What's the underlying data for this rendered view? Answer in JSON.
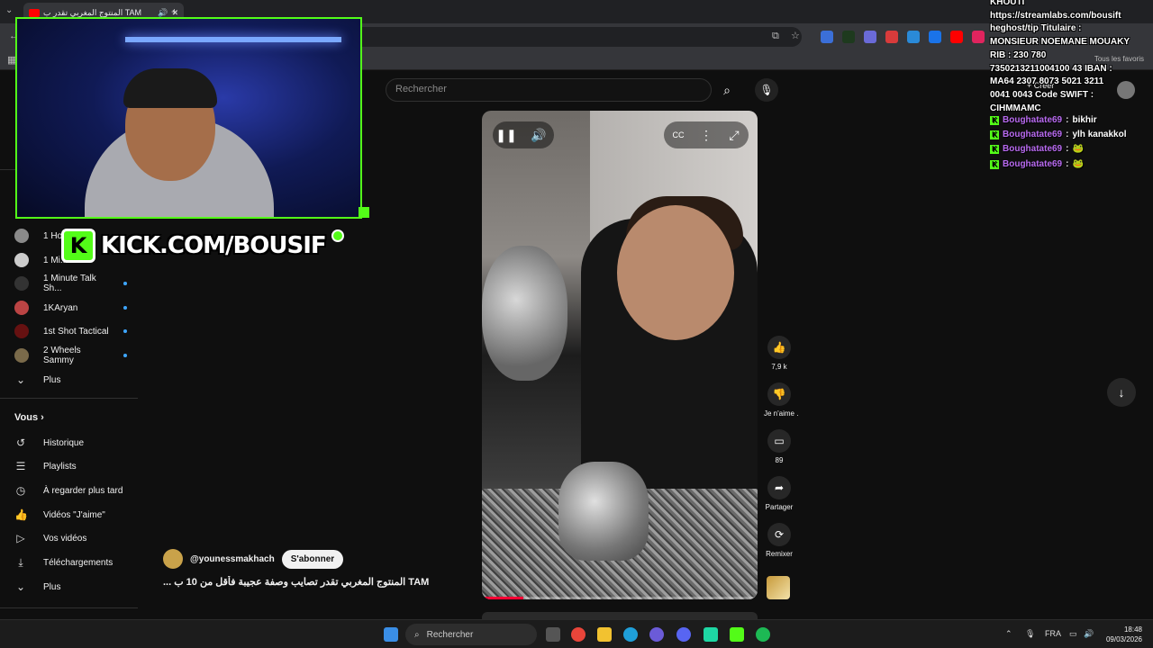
{
  "browser": {
    "tab_title": "المنتوج المغربي تقدر ب TAM",
    "bookmarks_label": "Tous les favoris"
  },
  "youtube": {
    "search_placeholder": "Rechercher",
    "create_label": "+ Créer",
    "sidebar": {
      "subscriptions": [
        {
          "label": "1 Ho..."
        },
        {
          "label": "1 Mi..."
        },
        {
          "label": "1 Minute Talk Sh..."
        },
        {
          "label": "1KAryan"
        },
        {
          "label": "1st Shot Tactical"
        },
        {
          "label": "2 Wheels Sammy"
        }
      ],
      "more_label": "Plus",
      "vous_label": "Vous",
      "items": [
        {
          "label": "Historique"
        },
        {
          "label": "Playlists"
        },
        {
          "label": "À regarder plus tard"
        },
        {
          "label": "Vidéos \"J'aime\""
        },
        {
          "label": "Vos vidéos"
        },
        {
          "label": "Téléchargements"
        },
        {
          "label": "Plus"
        }
      ]
    },
    "short": {
      "channel": "@younessmakhach",
      "subscribe": "S'abonner",
      "title": "... المنتوج المغربي  تقدر تصايب وصفة عجيبة فأقل من 10 ب TAM",
      "progress": 0.15
    },
    "actions": {
      "likes": "7,9 k",
      "dislike": "Je n'aime .",
      "comments": "89",
      "share": "Partager",
      "remix": "Remixer"
    }
  },
  "overlay": {
    "kick_url": "KICK.COM/BOUSIF",
    "chat_info": [
      "KHOUTI",
      "https://streamlabs.com/bousift",
      "heghost/tip Titulaire :",
      "MONSIEUR NOEMANE MOUAKY",
      "RIB : 230 780",
      "7350213211004100 43 IBAN :",
      "MA64 2307 8073 5021 3211",
      "0041 0043 Code SWIFT :",
      "CIHMMAMC"
    ],
    "chat": [
      {
        "user": "Boughatate69",
        "text": "bikhir"
      },
      {
        "user": "Boughatate69",
        "text": "ylh kanakkol"
      },
      {
        "user": "Boughatate69",
        "text": "🐸"
      },
      {
        "user": "Boughatate69",
        "text": "🐸"
      }
    ]
  },
  "taskbar": {
    "search_label": "Rechercher",
    "lang": "FRA",
    "time": "18:48",
    "date": "09/03/2026"
  }
}
